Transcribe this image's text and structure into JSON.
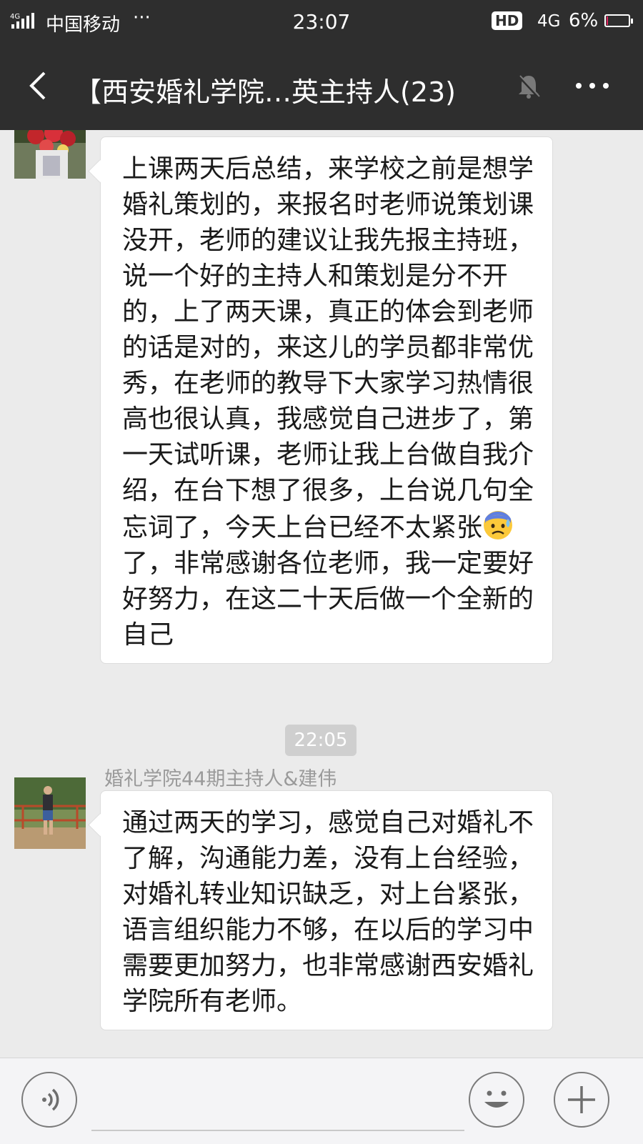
{
  "status": {
    "signal": "4G",
    "carrier": "中国移动",
    "dots": "···",
    "time": "23:07",
    "hd": "HD",
    "network": "4G",
    "battery": "6%",
    "battery_level": 0.06,
    "battery_color": "#e0245e"
  },
  "header": {
    "title": "【西安婚礼学院…英主持人(23)",
    "back_icon": "chevron-left-icon",
    "mute_icon": "bell-muted-icon",
    "more_icon": "more-dots-icon"
  },
  "messages": [
    {
      "sender": "",
      "text_before_emoji": "上课两天后总结，来学校之前是想学婚礼策划的，来报名时老师说策划课没开，老师的建议让我先报主持班，说一个好的主持人和策划是分不开的，上了两天课，真正的体会到老师的话是对的，来这儿的学员都非常优秀，在老师的教导下大家学习热情很高也很认真，我感觉自己进步了，第一天试听课，老师让我上台做自我介绍，在台下想了很多，上台说几句全忘词了，今天上台已经不太紧张",
      "emoji": "anxious-sweat-face",
      "text_after_emoji": "了，非常感谢各位老师，我一定要好好努力，在这二十天后做一个全新的自己"
    },
    {
      "sender": "婚礼学院44期主持人&建伟",
      "text": "通过两天的学习，感觉自己对婚礼不了解，沟通能力差，没有上台经验，对婚礼转业知识缺乏，对上台紧张，语言组织能力不够，在以后的学习中需要更加努力，也非常感谢西安婚礼学院所有老师。"
    }
  ],
  "timestamp": "22:05",
  "input_bar": {
    "voice_icon": "voice-icon",
    "emoji_icon": "smiley-icon",
    "plus_icon": "plus-icon"
  }
}
